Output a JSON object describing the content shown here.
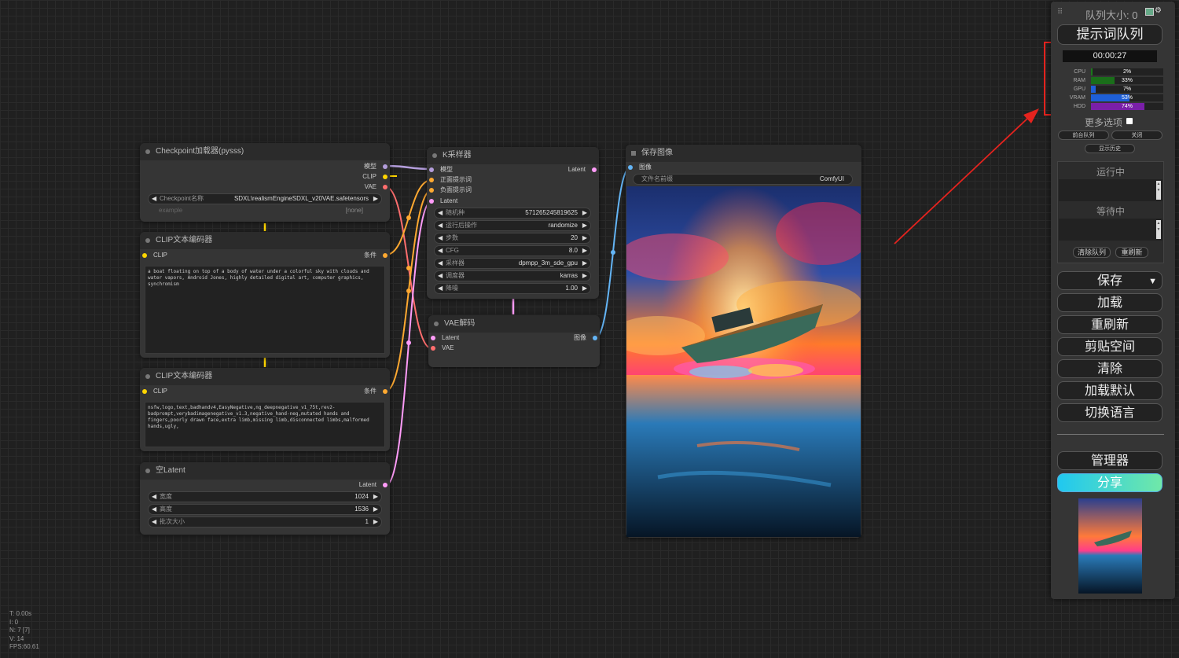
{
  "stats": {
    "t": "T: 0.00s",
    "i": "I: 0",
    "n": "N: 7 [7]",
    "v": "V: 14",
    "fps": "FPS:60.61"
  },
  "nodes": {
    "checkpoint": {
      "title": "Checkpoint加载器(pysss)",
      "outputs": [
        "模型",
        "CLIP",
        "VAE"
      ],
      "ckpt_label": "Checkpoint名称",
      "ckpt_value": "SDXL\\realismEngineSDXL_v20VAE.safetensors",
      "example_label": "example",
      "example_value": "[none]"
    },
    "clip_pos": {
      "title": "CLIP文本编码器",
      "input": "CLIP",
      "output": "条件",
      "text": "a boat floating on top of a body of water under a colorful sky with clouds and water vapors, Android Jones, highly detailed digital art, computer graphics, synchromism"
    },
    "clip_neg": {
      "title": "CLIP文本编码器",
      "input": "CLIP",
      "output": "条件",
      "text": "nsfw,logo,text,badhandv4,EasyNegative,ng_deepnegative_v1_75t,rev2-badprompt,verybadimagenegative_v1.3,negative_hand-neg,mutated hands and fingers,poorly drawn face,extra limb,missing limb,disconnected limbs,malformed hands,ugly,"
    },
    "latent": {
      "title": "空Latent",
      "output": "Latent",
      "widgets": [
        {
          "label": "宽度",
          "value": "1024"
        },
        {
          "label": "高度",
          "value": "1536"
        },
        {
          "label": "批次大小",
          "value": "1"
        }
      ]
    },
    "ksampler": {
      "title": "K采样器",
      "inputs": [
        "模型",
        "正面提示词",
        "负面提示词",
        "Latent"
      ],
      "output": "Latent",
      "widgets": [
        {
          "label": "随机种",
          "value": "571265245819625"
        },
        {
          "label": "运行后操作",
          "value": "randomize"
        },
        {
          "label": "步数",
          "value": "20"
        },
        {
          "label": "CFG",
          "value": "8.0"
        },
        {
          "label": "采样器",
          "value": "dpmpp_3m_sde_gpu"
        },
        {
          "label": "调度器",
          "value": "karras"
        },
        {
          "label": "降噪",
          "value": "1.00"
        }
      ]
    },
    "vaedecode": {
      "title": "VAE解码",
      "inputs": [
        "Latent",
        "VAE"
      ],
      "output": "图像"
    },
    "save": {
      "title": "保存图像",
      "input": "图像",
      "prefix_label": "文件名前缀",
      "prefix_value": "ComfyUI"
    }
  },
  "panel": {
    "queue_size": "队列大小: 0",
    "queue_prompt": "提示词队列",
    "timer": "00:00:27",
    "monitors": [
      {
        "label": "CPU",
        "pct": "2%",
        "value": 2,
        "color": "#1a7a1a"
      },
      {
        "label": "RAM",
        "pct": "33%",
        "value": 33,
        "color": "#1a6e1a"
      },
      {
        "label": "GPU",
        "pct": "7%",
        "value": 7,
        "color": "#1e5fd8"
      },
      {
        "label": "VRAM",
        "pct": "53%",
        "value": 53,
        "color": "#1e5fd8"
      },
      {
        "label": "HDD",
        "pct": "74%",
        "value": 74,
        "color": "#7a1fa8"
      }
    ],
    "more_options": "更多选项",
    "front_queue": "前台队列",
    "close": "关闭",
    "show_history": "显示历史",
    "running": "运行中",
    "pending": "等待中",
    "clear_queue": "清除队列",
    "refresh": "重刷新",
    "save": "保存",
    "load": "加载",
    "refresh_big": "重刷新",
    "clipspace": "剪贴空间",
    "clear": "清除",
    "load_default": "加载默认",
    "switch_lang": "切换语言",
    "manager": "管理器",
    "share": "分享"
  },
  "colors": {
    "highlight": "#e5231e",
    "model": "#b39ddb",
    "clip": "#ffd500",
    "vae": "#ff6e6e",
    "conditioning": "#ffa931",
    "latent": "#ff9cf9",
    "image": "#64b5f6"
  }
}
